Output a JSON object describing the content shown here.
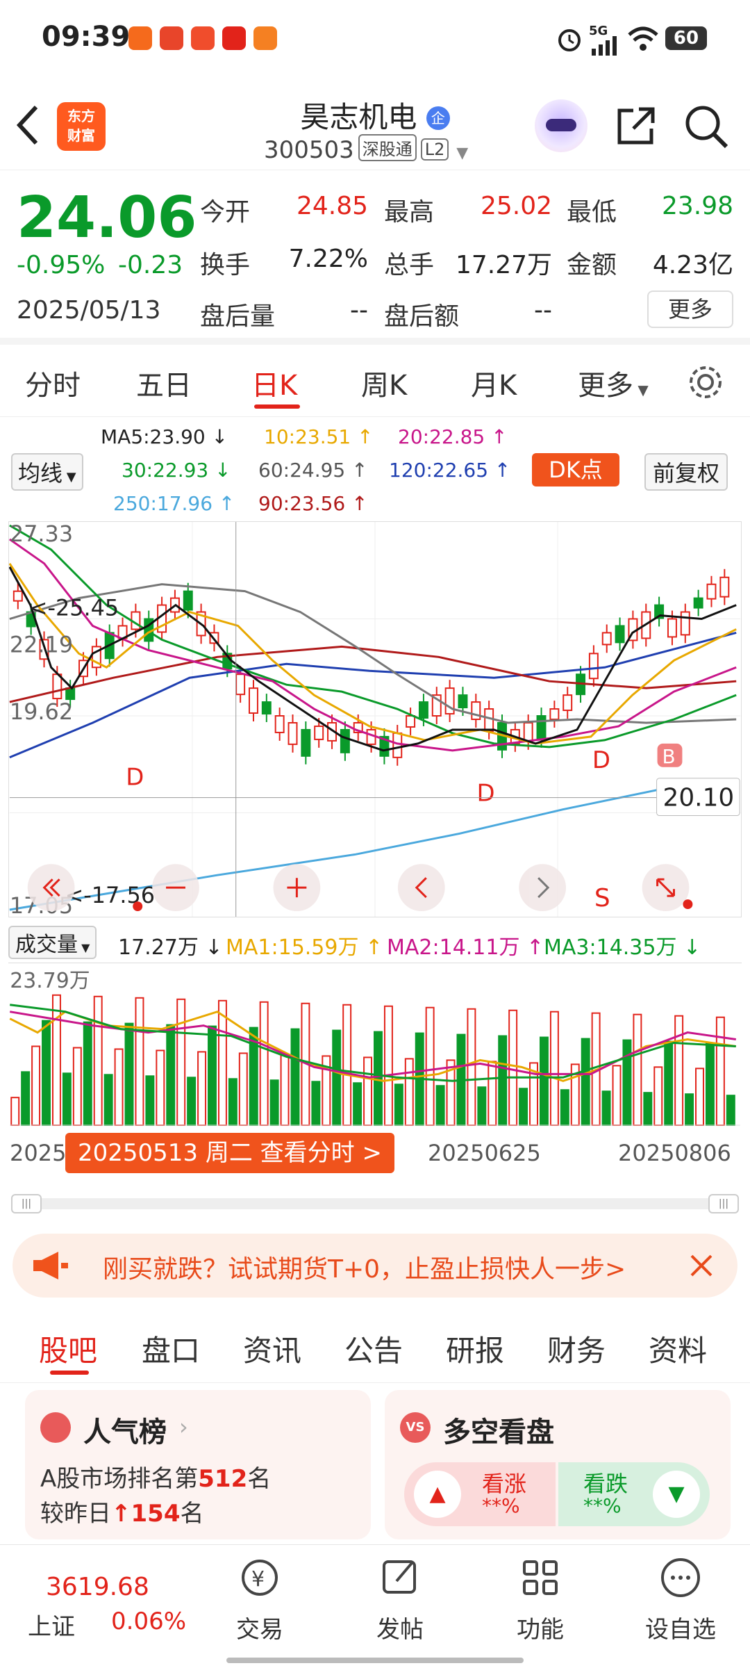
{
  "status_bar": {
    "time": "09:39",
    "battery": "60",
    "network": "5G"
  },
  "header": {
    "logo_text_1": "东方",
    "logo_text_2": "财富",
    "stock_name": "昊志机电",
    "stock_code": "300503",
    "badge_1": "深股通",
    "badge_2": "L2"
  },
  "quote": {
    "price": "24.06",
    "change_pct": "-0.95%",
    "change_amt": "-0.23",
    "date": "2025/05/13",
    "open_label": "今开",
    "open": "24.85",
    "high_label": "最高",
    "high": "25.02",
    "low_label": "最低",
    "low": "23.98",
    "turnover_label": "换手",
    "turnover": "7.22%",
    "volume_label": "总手",
    "volume": "17.27万",
    "amount_label": "金额",
    "amount": "4.23亿",
    "after_vol_label": "盘后量",
    "after_vol": "--",
    "after_amt_label": "盘后额",
    "after_amt": "--",
    "more_button": "更多"
  },
  "tabs": [
    "分时",
    "五日",
    "日K",
    "周K",
    "月K",
    "更多"
  ],
  "ma_legend": {
    "selector": "均线",
    "ma5": "MA5:23.90 ↓",
    "ma10": "10:23.51 ↑",
    "ma20": "20:22.85 ↑",
    "ma30": "30:22.93 ↓",
    "ma60": "60:24.95 ↑",
    "ma120": "120:22.65 ↑",
    "ma250": "250:17.96 ↑",
    "ma90": "90:23.56 ↑",
    "dk_button": "DK点",
    "adjust_button": "前复权"
  },
  "chart": {
    "y_labels": [
      "27.33",
      "22.19",
      "19.62",
      "17.05"
    ],
    "high_marker": "<-25.45",
    "low_marker": "<-17.56",
    "price_tag": "20.10",
    "signals": [
      "D",
      "D",
      "D",
      "B",
      "S"
    ]
  },
  "volume": {
    "selector": "成交量",
    "vol": "17.27万 ↓",
    "ma1": "MA1:15.59万 ↑",
    "ma2": "MA2:14.11万 ↑",
    "ma3": "MA3:14.35万 ↓",
    "y_label": "23.79万",
    "x_label_1": "2025",
    "x_label_2": "20250625",
    "x_label_3": "20250806",
    "tooltip": "20250513 周二  查看分时 >"
  },
  "promo": {
    "text": "刚买就跌？试试期货T+0，止盈止损快人一步>"
  },
  "bottom_tabs": [
    "股吧",
    "盘口",
    "资讯",
    "公告",
    "研报",
    "财务",
    "资料"
  ],
  "popularity": {
    "title": "人气榜",
    "rank_prefix": "A股市场排名第",
    "rank": "512",
    "rank_suffix": "名",
    "change_prefix": "较昨日",
    "change": "154",
    "change_suffix": "名"
  },
  "sentiment": {
    "title": "多空看盘",
    "bull_label": "看涨",
    "bull_value": "**%",
    "bear_label": "看跌",
    "bear_value": "**%"
  },
  "bottom_bar": {
    "index_value": "3619.68",
    "index_name": "上证",
    "index_change": "0.06%",
    "items": [
      "交易",
      "发帖",
      "功能",
      "设自选"
    ]
  },
  "colors": {
    "up": "#e2231a",
    "down": "#0a9a2a",
    "accent": "#ff5a1f"
  }
}
